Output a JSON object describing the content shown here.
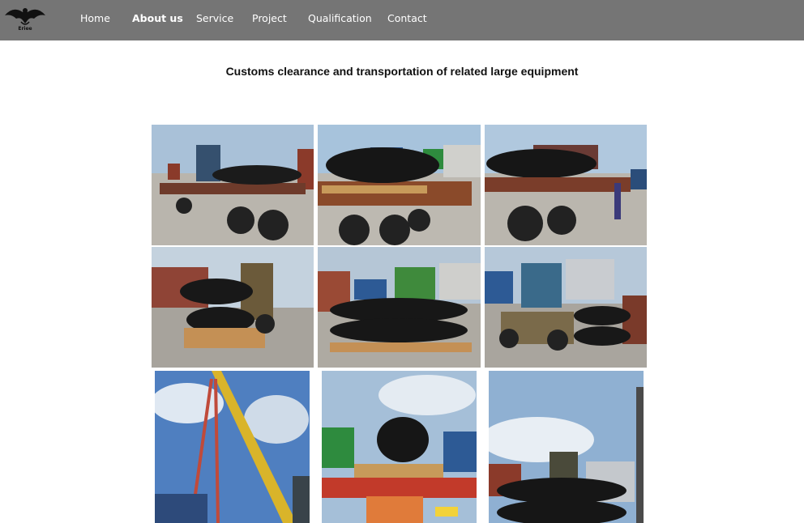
{
  "brand": {
    "logo_icon": "eagle-logo-icon",
    "logo_text": "Eriee"
  },
  "nav": {
    "items": [
      {
        "label": "Home",
        "active": false
      },
      {
        "label": "About us",
        "active": true
      },
      {
        "label": "Service",
        "active": false
      },
      {
        "label": "Project",
        "active": false
      },
      {
        "label": "Qualification",
        "active": false
      },
      {
        "label": "Contact",
        "active": false
      }
    ]
  },
  "main": {
    "title": "Customs clearance and transportation of related large equipment"
  },
  "colors": {
    "navbar_bg": "#757575",
    "nav_text": "#ffffff",
    "title_text": "#111111",
    "page_bg": "#ffffff"
  },
  "gallery": {
    "photo_count": 9,
    "photo_icons": [
      "truck-with-pipe-photo",
      "truck-with-pipe-photo",
      "truck-with-pipe-photo",
      "forklift-pipes-photo",
      "pallet-pipes-photo",
      "forklift-pipes-photo",
      "crane-photo",
      "truck-rear-photo",
      "stacked-pipes-photo"
    ]
  }
}
